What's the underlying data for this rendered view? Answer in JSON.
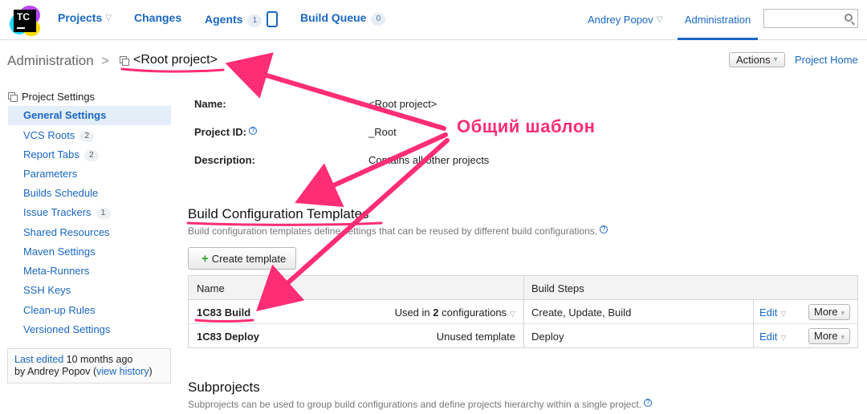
{
  "topbar": {
    "logo_text": "TC",
    "nav": [
      {
        "label": "Projects",
        "has_caret": true
      },
      {
        "label": "Changes"
      },
      {
        "label": "Agents",
        "count": "1"
      },
      {
        "label": "Build Queue",
        "count": "0"
      }
    ],
    "user_name": "Andrey Popov",
    "admin_tab": "Administration",
    "search_value": ""
  },
  "breadcrumb": {
    "admin": "Administration",
    "separator": ">",
    "project": "<Root project>"
  },
  "header_actions": {
    "actions_label": "Actions",
    "project_home": "Project Home"
  },
  "sidebar": {
    "heading": "Project Settings",
    "items": [
      {
        "label": "General Settings",
        "active": true
      },
      {
        "label": "VCS Roots",
        "badge": "2"
      },
      {
        "label": "Report Tabs",
        "badge": "2"
      },
      {
        "label": "Parameters"
      },
      {
        "label": "Builds Schedule"
      },
      {
        "label": "Issue Trackers",
        "badge": "1"
      },
      {
        "label": "Shared Resources"
      },
      {
        "label": "Maven Settings"
      },
      {
        "label": "Meta-Runners"
      },
      {
        "label": "SSH Keys"
      },
      {
        "label": "Clean-up Rules"
      },
      {
        "label": "Versioned Settings"
      }
    ],
    "last_edited": {
      "prefix": "Last edited",
      "when": "10 months ago",
      "by": "by Andrey Popov",
      "history_link": "view history"
    }
  },
  "properties": [
    {
      "label": "Name:",
      "value": "<Root project>"
    },
    {
      "label": "Project ID:",
      "value": "_Root",
      "help": true
    },
    {
      "label": "Description:",
      "value": "Contains all other projects"
    }
  ],
  "templates_section": {
    "title": "Build Configuration Templates",
    "description": "Build configuration templates define settings that can be reused by different build configurations.",
    "create_button": "Create template",
    "columns": [
      "Name",
      "Build Steps"
    ],
    "rows": [
      {
        "name": "1C83 Build",
        "usage_prefix": "Used in",
        "usage_count": "2",
        "usage_suffix": "configurations",
        "steps": "Create, Update, Build",
        "edit": "Edit",
        "more": "More"
      },
      {
        "name": "1C83 Deploy",
        "usage_text": "Unused template",
        "steps": "Deploy",
        "edit": "Edit",
        "more": "More"
      }
    ]
  },
  "subprojects_section": {
    "title": "Subprojects",
    "description": "Subprojects can be used to group build configurations and define projects hierarchy within a single project."
  },
  "annotation": {
    "label": "Общий шаблон",
    "color": "#ff2d73"
  }
}
